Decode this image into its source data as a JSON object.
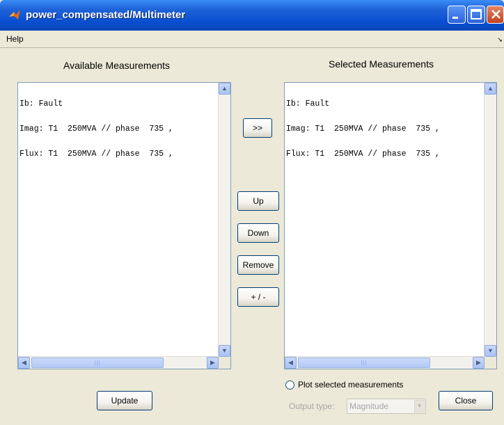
{
  "window": {
    "title": "power_compensated/Multimeter"
  },
  "menu": {
    "help": "Help"
  },
  "available": {
    "heading": "Available Measurements",
    "items": [
      "Ib: Fault",
      "Imag: T1  250MVA // phase  735 ,",
      "Flux: T1  250MVA // phase  735 ,"
    ]
  },
  "selected": {
    "heading": "Selected Measurements",
    "items": [
      "Ib: Fault",
      "Imag: T1  250MVA // phase  735 ,",
      "Flux: T1  250MVA // phase  735 ,"
    ]
  },
  "buttons": {
    "add": ">>",
    "up": "Up",
    "down": "Down",
    "remove": "Remove",
    "invert": "+ / -",
    "update": "Update",
    "close": "Close"
  },
  "plot": {
    "label": "Plot selected measurements",
    "checked": false
  },
  "output": {
    "label": "Output type:",
    "value": "Magnitude"
  },
  "icons": {
    "app": "matlab-logo-icon",
    "minimize": "minimize-icon",
    "maximize": "maximize-icon",
    "close": "close-icon",
    "scroll_up": "scroll-up-arrow-icon",
    "scroll_down": "scroll-down-arrow-icon",
    "scroll_left": "scroll-left-arrow-icon",
    "scroll_right": "scroll-right-arrow-icon",
    "dropdown": "chevron-down-icon"
  }
}
